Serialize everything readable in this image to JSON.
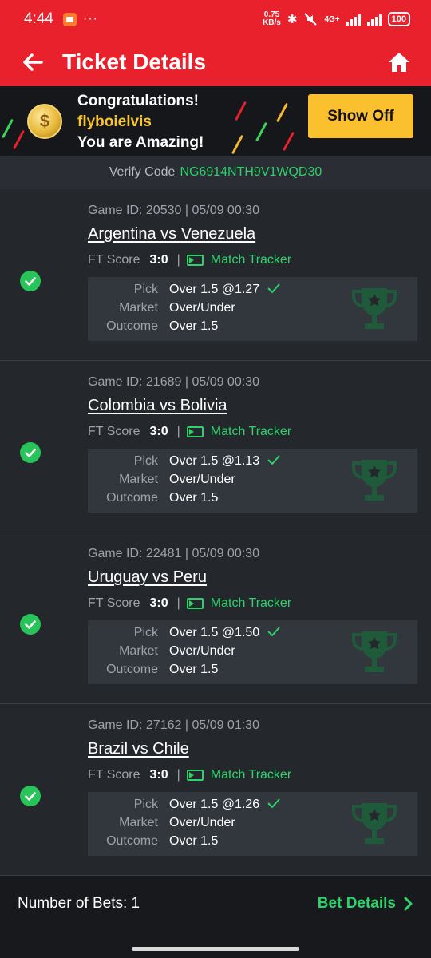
{
  "status_bar": {
    "time": "4:44",
    "dots": "···",
    "speed_value": "0.75",
    "speed_unit": "KB/s",
    "network": "4G+",
    "battery": "100"
  },
  "header": {
    "title": "Ticket Details",
    "icons": {
      "back": "back-arrow-icon",
      "home": "home-icon"
    }
  },
  "banner": {
    "line1": "Congratulations!",
    "username": "flyboielvis",
    "line3": "You are Amazing!",
    "coin_symbol": "$",
    "show_off_label": "Show Off"
  },
  "verify": {
    "label": "Verify Code",
    "code": "NG6914NTH9V1WQD30"
  },
  "bets": [
    {
      "meta": "Game ID: 20530 | 05/09 00:30",
      "teams": "Argentina vs Venezuela",
      "ft_label": "FT Score",
      "ft_score": "3:0",
      "separator": "|",
      "tracker_label": "Match Tracker",
      "pick_label": "Pick",
      "pick_value": "Over 1.5 @1.27",
      "market_label": "Market",
      "market_value": "Over/Under",
      "outcome_label": "Outcome",
      "outcome_value": "Over 1.5",
      "status": "won"
    },
    {
      "meta": "Game ID: 21689 | 05/09 00:30",
      "teams": "Colombia vs Bolivia",
      "ft_label": "FT Score",
      "ft_score": "3:0",
      "separator": "|",
      "tracker_label": "Match Tracker",
      "pick_label": "Pick",
      "pick_value": "Over 1.5 @1.13",
      "market_label": "Market",
      "market_value": "Over/Under",
      "outcome_label": "Outcome",
      "outcome_value": "Over 1.5",
      "status": "won"
    },
    {
      "meta": "Game ID: 22481 | 05/09 00:30",
      "teams": "Uruguay vs Peru",
      "ft_label": "FT Score",
      "ft_score": "3:0",
      "separator": "|",
      "tracker_label": "Match Tracker",
      "pick_label": "Pick",
      "pick_value": "Over 1.5 @1.50",
      "market_label": "Market",
      "market_value": "Over/Under",
      "outcome_label": "Outcome",
      "outcome_value": "Over 1.5",
      "status": "won"
    },
    {
      "meta": "Game ID: 27162 | 05/09 01:30",
      "teams": "Brazil vs Chile",
      "ft_label": "FT Score",
      "ft_score": "3:0",
      "separator": "|",
      "tracker_label": "Match Tracker",
      "pick_label": "Pick",
      "pick_value": "Over 1.5 @1.26",
      "market_label": "Market",
      "market_value": "Over/Under",
      "outcome_label": "Outcome",
      "outcome_value": "Over 1.5",
      "status": "won"
    }
  ],
  "footer": {
    "num_bets": "Number of Bets: 1",
    "bet_details_label": "Bet Details"
  },
  "colors": {
    "brand_red": "#e8212c",
    "accent_green": "#2bd36a",
    "gold": "#fbc02d",
    "background": "#24272c"
  }
}
